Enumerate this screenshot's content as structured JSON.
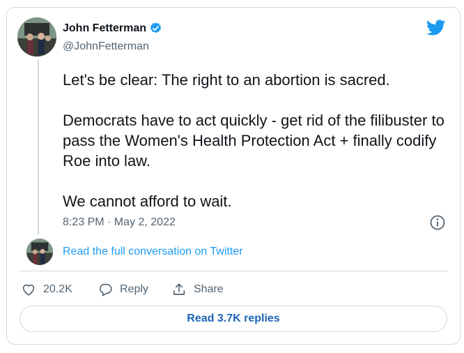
{
  "author": {
    "name": "John Fetterman",
    "handle": "@JohnFetterman",
    "verified": true
  },
  "tweet": {
    "paragraphs": [
      "Let's be clear: The right to an abortion is sacred.",
      "Democrats have to act quickly - get rid of the filibuster to pass the Women's Health Protection Act + finally codify Roe into law.",
      "We cannot afford to wait."
    ],
    "timestamp": "8:23 PM · May 2, 2022"
  },
  "conversation_link": "Read the full conversation on Twitter",
  "actions": {
    "like_count": "20.2K",
    "reply_label": "Reply",
    "share_label": "Share"
  },
  "read_replies_label": "Read 3.7K replies",
  "icons": {
    "brand": "twitter-bird-icon",
    "verified": "verified-badge-icon",
    "info": "info-icon",
    "like": "heart-icon",
    "reply": "reply-bubble-icon",
    "share": "share-icon"
  },
  "colors": {
    "accent": "#1d9bf0",
    "text": "#0f1419",
    "muted": "#536471",
    "border": "#cfd9de"
  }
}
